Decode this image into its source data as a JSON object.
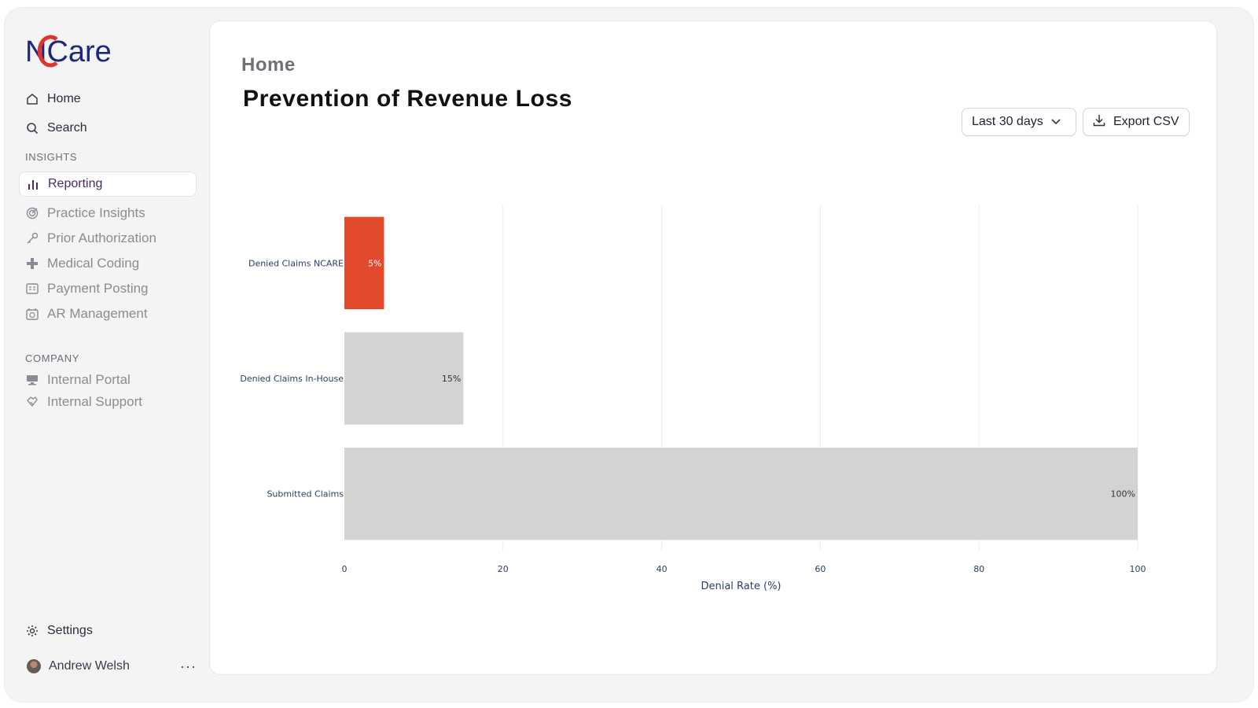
{
  "app": {
    "logo_text": "NCare"
  },
  "sidebar": {
    "top_items": [
      {
        "label": "Home",
        "icon": "home-icon"
      },
      {
        "label": "Search",
        "icon": "search-icon"
      }
    ],
    "insights_label": "INSIGHTS",
    "insights_items": [
      {
        "label": "Reporting",
        "icon": "bar-chart-icon",
        "active": true
      },
      {
        "label": "Practice Insights",
        "icon": "target-icon"
      },
      {
        "label": "Prior Authorization",
        "icon": "key-icon"
      },
      {
        "label": "Medical Coding",
        "icon": "plus-icon"
      },
      {
        "label": "Payment Posting",
        "icon": "receipt-icon"
      },
      {
        "label": "AR Management",
        "icon": "calendar-dollar-icon"
      }
    ],
    "company_label": "COMPANY",
    "company_items": [
      {
        "label": "Internal Portal",
        "icon": "monitor-icon"
      },
      {
        "label": "Internal Support",
        "icon": "handshake-icon"
      }
    ],
    "settings_label": "Settings",
    "user_name": "Andrew Welsh",
    "more_label": "···"
  },
  "header": {
    "breadcrumb": "Home",
    "title": "Prevention of Revenue Loss",
    "range_label": "Last 30 days",
    "export_label": "Export CSV"
  },
  "colors": {
    "accent_bar": "#e24a2d",
    "neutral_bar": "#d3d3d3",
    "axis_text": "#2a3f66",
    "active_nav": "#4a2a6a"
  },
  "chart_data": {
    "type": "bar",
    "orientation": "horizontal",
    "categories": [
      "Denied Claims NCARE",
      "Denied Claims In-House",
      "Submitted Claims"
    ],
    "values": [
      5,
      15,
      100
    ],
    "data_labels": [
      "5%",
      "15%",
      "100%"
    ],
    "colors": [
      "#e24a2d",
      "#d3d3d3",
      "#d3d3d3"
    ],
    "xlabel": "Denial Rate (%)",
    "ylabel": "",
    "xlim": [
      0,
      100
    ],
    "xticks": [
      0,
      20,
      40,
      60,
      80,
      100
    ],
    "grid": "vertical"
  }
}
